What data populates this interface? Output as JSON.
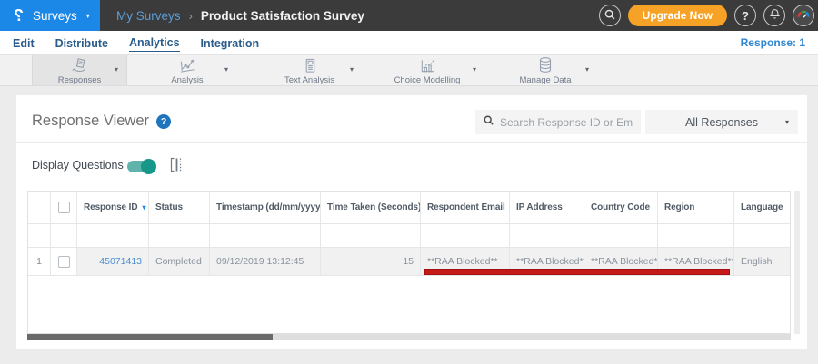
{
  "topbar": {
    "logo_glyph": "?",
    "product_menu": {
      "label": "Surveys",
      "caret": "▾"
    },
    "breadcrumb": {
      "parent": "My Surveys",
      "separator": "›",
      "current": "Product Satisfaction Survey"
    },
    "upgrade_button": "Upgrade Now",
    "help_glyph": "?"
  },
  "nav": {
    "tabs": [
      {
        "label": "Edit"
      },
      {
        "label": "Distribute"
      },
      {
        "label": "Analytics"
      },
      {
        "label": "Integration"
      }
    ],
    "active_tab": "Analytics",
    "response_count": "Response: 1"
  },
  "toolbar": {
    "caret": "▾",
    "items": [
      {
        "label": "Responses",
        "selected": true
      },
      {
        "label": "Analysis",
        "selected": false
      },
      {
        "label": "Text Analysis",
        "selected": false
      },
      {
        "label": "Choice Modelling",
        "selected": false
      },
      {
        "label": "Manage Data",
        "selected": false
      }
    ]
  },
  "main": {
    "title": "Response Viewer",
    "help_glyph": "?",
    "search": {
      "placeholder": "Search Response ID or Email",
      "value": ""
    },
    "filter_dropdown": {
      "value": "All Responses",
      "caret": "▾"
    },
    "display_questions": {
      "label": "Display Questions",
      "state": "on"
    }
  },
  "table": {
    "headers": {
      "response_id": "Response ID",
      "status": "Status",
      "timestamp": "Timestamp (dd/mm/yyyy)",
      "time_taken": "Time Taken (Seconds)",
      "respondent_email": "Respondent Email",
      "ip_address": "IP Address",
      "country_code": "Country Code",
      "region": "Region",
      "language": "Language"
    },
    "sort": {
      "response_id_caret": "▾",
      "updown": "⇅"
    },
    "rows": [
      {
        "num": "1",
        "response_id": "45071413",
        "status": "Completed",
        "timestamp": "09/12/2019 13:12:45",
        "time_taken": "15",
        "respondent_email": "**RAA Blocked**",
        "ip_address": "**RAA Blocked**",
        "country_code": "**RAA Blocked**",
        "region": "**RAA Blocked**",
        "language": "English"
      }
    ]
  },
  "colors": {
    "brand_blue": "#1B87E6",
    "topbar_bg": "#3B3B3B",
    "upgrade_orange": "#F6A226",
    "toggle_teal": "#17968A",
    "annotation_red": "#C41A1A",
    "link_blue": "#4A90D2"
  }
}
